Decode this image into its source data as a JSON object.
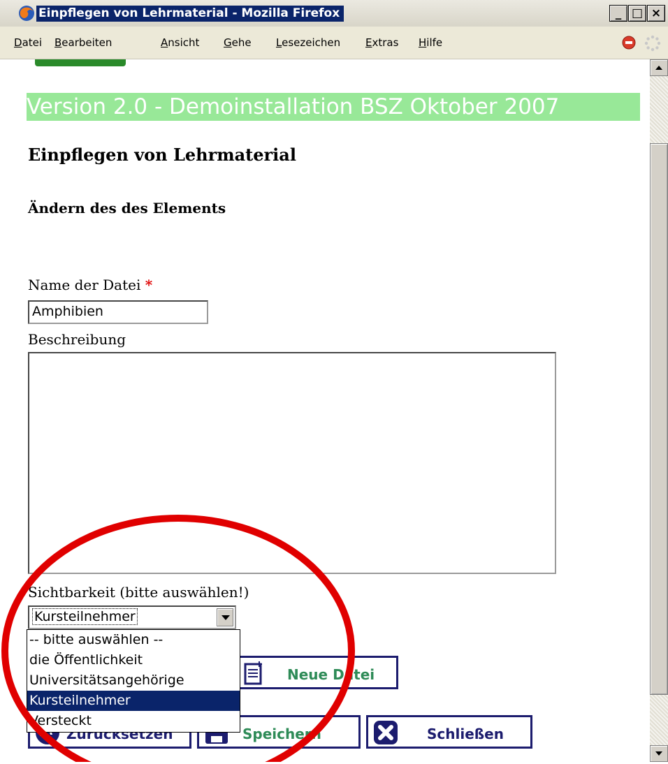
{
  "window": {
    "title": "Einpflegen von Lehrmaterial - Mozilla Firefox",
    "controls": {
      "minimize": "_",
      "maximize": "□",
      "close": "×"
    }
  },
  "menubar": {
    "items": [
      "Datei",
      "Bearbeiten",
      "Ansicht",
      "Gehe",
      "Lesezeichen",
      "Extras",
      "Hilfe"
    ]
  },
  "page": {
    "version_banner": "Version 2.0 - Demoinstallation BSZ Oktober 2007",
    "heading": "Einpflegen von Lehrmaterial",
    "subheading": "Ändern des des Elements",
    "form": {
      "filename_label": "Name der Datei",
      "required_marker": "*",
      "filename_value": "Amphibien",
      "description_label": "Beschreibung",
      "description_value": "",
      "visibility_label": "Sichtbarkeit (bitte auswählen!)",
      "visibility_selected": "Kursteilnehmer",
      "visibility_options": [
        "-- bitte auswählen --",
        "die Öffentlichkeit",
        "Universitätsangehörige",
        "Kursteilnehmer",
        "Versteckt"
      ]
    },
    "buttons": {
      "new_file": "Neue Datei",
      "reset": "Zurücksetzen",
      "save": "Speichern",
      "close": "Schließen"
    }
  },
  "colors": {
    "banner_bg": "#98e898",
    "button_border": "#1c1c6e",
    "button_text": "#2e8b57",
    "highlight": "#0a246a",
    "annotation": "#e00000"
  }
}
